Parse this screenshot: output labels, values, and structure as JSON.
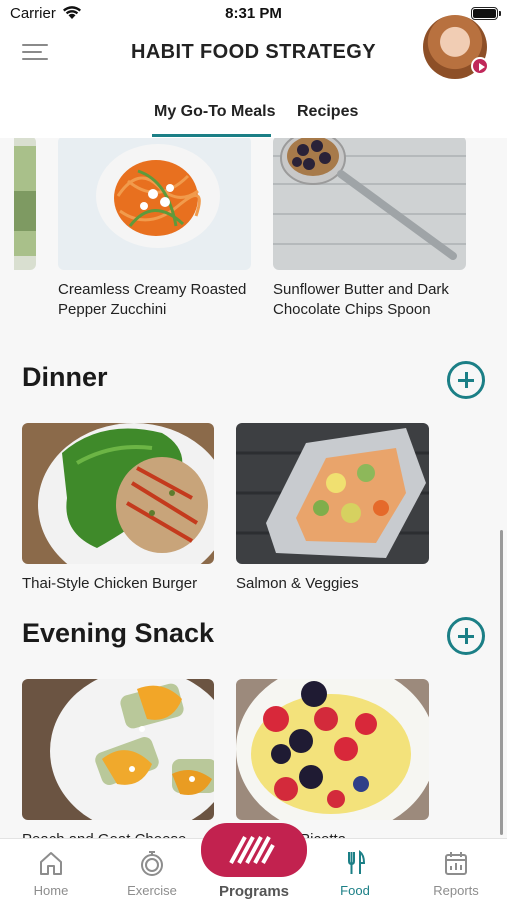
{
  "status_bar": {
    "carrier": "Carrier",
    "time": "8:31 PM"
  },
  "header": {
    "title": "HABIT FOOD STRATEGY"
  },
  "tabs": [
    {
      "label": "My Go-To Meals",
      "active": true
    },
    {
      "label": "Recipes",
      "active": false
    }
  ],
  "sections": {
    "snack_top": {
      "cards": [
        {
          "title": "Creamless Creamy Roasted Pepper Zucchini"
        },
        {
          "title": "Sunflower Butter and Dark Chocolate Chips Spoon"
        }
      ]
    },
    "dinner": {
      "title": "Dinner",
      "cards": [
        {
          "title": "Thai-Style Chicken Burger"
        },
        {
          "title": "Salmon & Veggies"
        }
      ]
    },
    "evening_snack": {
      "title": "Evening Snack",
      "cards": [
        {
          "title": "Peach and Goat Cheese..."
        },
        {
          "title": "...es with Ricotta"
        }
      ]
    }
  },
  "tab_bar": {
    "items": [
      {
        "label": "Home",
        "icon": "home-icon"
      },
      {
        "label": "Exercise",
        "icon": "stopwatch-icon"
      },
      {
        "label": "Programs",
        "icon": "programs-logo-icon"
      },
      {
        "label": "Food",
        "icon": "fork-knife-icon",
        "active": true
      },
      {
        "label": "Reports",
        "icon": "calendar-report-icon"
      }
    ]
  },
  "colors": {
    "accent": "#1b7f86",
    "brand": "#c2224f"
  }
}
